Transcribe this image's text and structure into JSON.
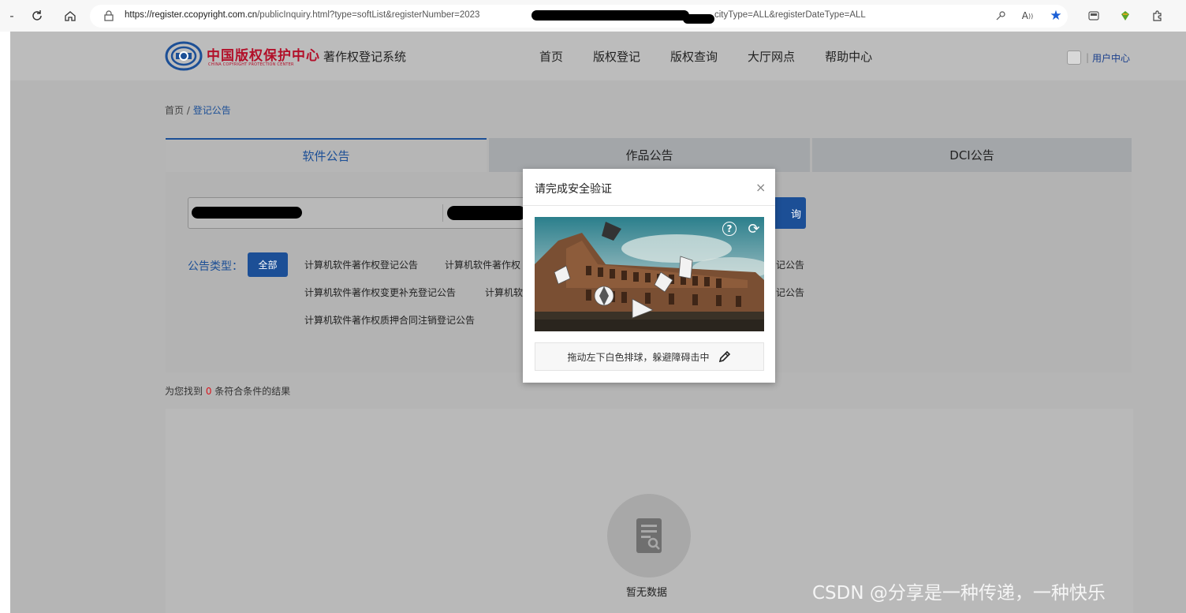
{
  "browser": {
    "url_domain": "https://register.ccopyright.com.cn",
    "url_path": "/publicInquiry.html?type=softList&registerNumber=2023",
    "url_tail": "cityType=ALL&registerDateType=ALL"
  },
  "header": {
    "logo_cn": "中国版权保护中心",
    "logo_en": "CHINA COPYRIGHT PROTECTION CENTER",
    "system_name": "著作权登记系统",
    "nav": [
      "首页",
      "版权登记",
      "版权查询",
      "大厅网点",
      "帮助中心"
    ],
    "user_center": "用户中心"
  },
  "breadcrumb": {
    "home": "首页",
    "separator": " / ",
    "current": "登记公告"
  },
  "tabs": [
    "软件公告",
    "作品公告",
    "DCI公告"
  ],
  "search": {
    "button_partial": "询"
  },
  "filters": {
    "label": "公告类型：",
    "all": "全部",
    "items": [
      "计算机软件著作权登记公告",
      "计算机软件著作权",
      "记公告",
      "计算机软件著作权变更补充登记公告",
      "计算机软",
      "记公告",
      "计算机软件著作权质押合同注销登记公告"
    ]
  },
  "results": {
    "prefix": "为您找到 ",
    "count": "0",
    "suffix": " 条符合条件的结果",
    "empty_text": "暂无数据"
  },
  "captcha": {
    "title": "请完成安全验证",
    "close": "×",
    "help": "?",
    "refresh": "⟳",
    "instruction": "拖动左下白色排球，躲避障碍击中"
  },
  "watermark": "CSDN @分享是一种传递，一种快乐",
  "colors": {
    "brand_blue": "#1c4f96",
    "logo_red": "#b2102a",
    "count_red": "#d9141c"
  }
}
